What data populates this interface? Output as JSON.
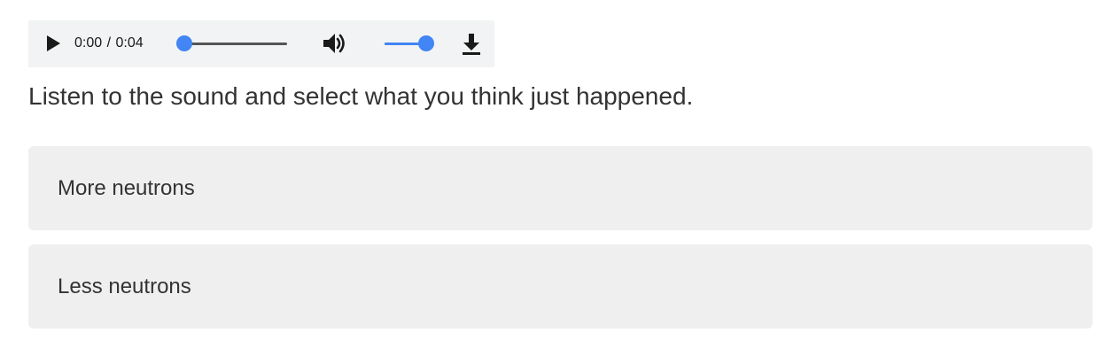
{
  "audio_player": {
    "current_time": "0:00",
    "separator": "/",
    "duration": "0:04",
    "progress_fraction": 0,
    "volume_fraction": 1,
    "icons": {
      "play": "play-icon",
      "volume": "volume-icon",
      "download": "download-icon"
    },
    "accent_color": "#4285f4"
  },
  "prompt": {
    "text": "Listen to the sound and select what you think just happened."
  },
  "options": [
    {
      "label": "More neutrons"
    },
    {
      "label": "Less neutrons"
    }
  ]
}
